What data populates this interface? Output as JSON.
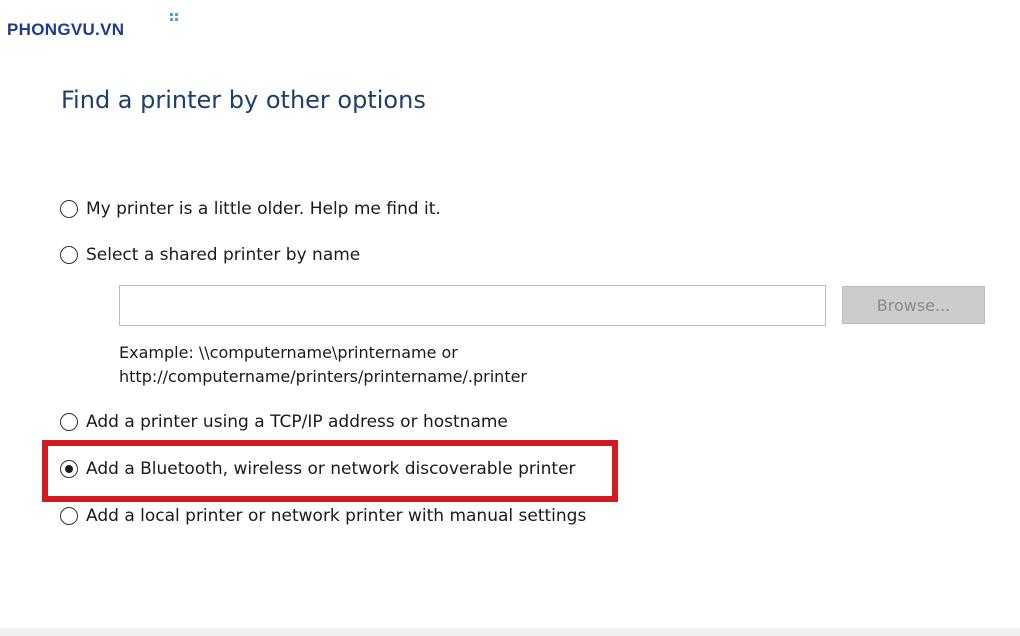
{
  "watermark": {
    "text": "PHONGVU.VN",
    "color": "#1f3a8f",
    "accent": "#4aa3df"
  },
  "dialog": {
    "title": "Find a printer by other options",
    "options": [
      {
        "label": "My printer is a little older. Help me find it.",
        "checked": false
      },
      {
        "label": "Select a shared printer by name",
        "checked": false
      },
      {
        "label": "Add a printer using a TCP/IP address or hostname",
        "checked": false
      },
      {
        "label": "Add a Bluetooth, wireless or network discoverable printer",
        "checked": true
      },
      {
        "label": "Add a local printer or network printer with manual settings",
        "checked": false
      }
    ],
    "shared_printer_input": {
      "value": "",
      "placeholder": ""
    },
    "browse_label": "Browse...",
    "example_line1": "Example: \\\\computername\\printername or",
    "example_line2": "http://computername/printers/printername/.printer"
  },
  "colors": {
    "title": "#1e3e6b",
    "highlight": "#d11a22",
    "browse_disabled": "#cccccc"
  }
}
